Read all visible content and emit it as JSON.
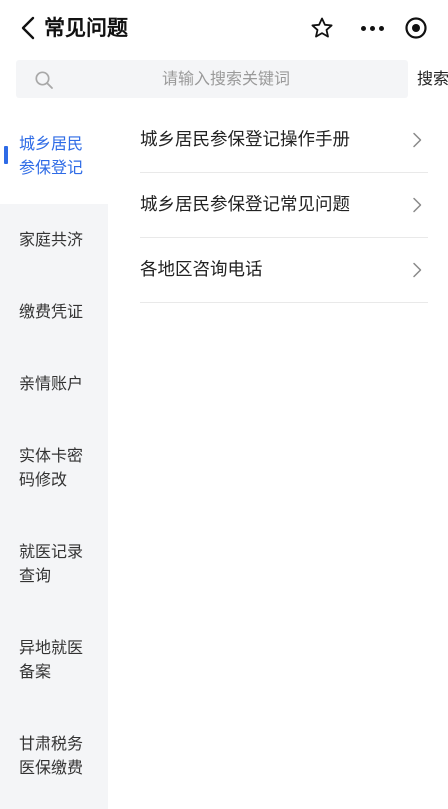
{
  "header": {
    "back_icon": "chevron-left-icon",
    "title": "常见问题",
    "actions": [
      "star-icon",
      "more-dots-icon",
      "target-icon"
    ]
  },
  "search": {
    "placeholder": "请输入搜索关键词",
    "button_label": "搜索",
    "icon": "search-icon"
  },
  "sidebar": {
    "accent_color": "#2e6be6",
    "active_index": 0,
    "items": [
      {
        "line1": "城乡居民",
        "line2": "参保登记"
      },
      {
        "line1": "家庭共济",
        "line2": ""
      },
      {
        "line1": "缴费凭证",
        "line2": ""
      },
      {
        "line1": "亲情账户",
        "line2": ""
      },
      {
        "line1": "实体卡密",
        "line2": "码修改"
      },
      {
        "line1": "就医记录",
        "line2": "查询"
      },
      {
        "line1": "异地就医",
        "line2": "备案"
      },
      {
        "line1": "甘肃税务",
        "line2": "医保缴费"
      }
    ]
  },
  "list": {
    "items": [
      {
        "label": "城乡居民参保登记操作手册",
        "icon": "chevron-right-icon"
      },
      {
        "label": "城乡居民参保登记常见问题",
        "icon": "chevron-right-icon"
      },
      {
        "label": "各地区咨询电话",
        "icon": "chevron-right-icon"
      }
    ]
  }
}
